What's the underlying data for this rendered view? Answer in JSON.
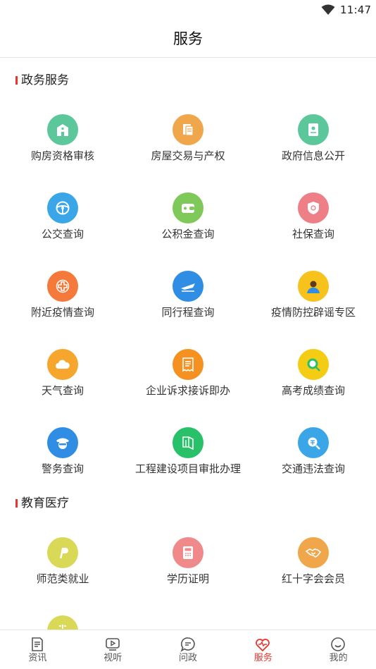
{
  "status_bar": {
    "time": "11:47"
  },
  "header": {
    "title": "服务"
  },
  "sections": [
    {
      "title": "政务服务",
      "items": [
        {
          "label": "购房资格审核",
          "icon": "building-icon",
          "color": "#5cc79a"
        },
        {
          "label": "房屋交易与产权",
          "icon": "document-icon",
          "color": "#f0a64a"
        },
        {
          "label": "政府信息公开",
          "icon": "info-card-icon",
          "color": "#5cc79a"
        },
        {
          "label": "公交查询",
          "icon": "steering-wheel-icon",
          "color": "#3aa6e8"
        },
        {
          "label": "公积金查询",
          "icon": "wallet-icon",
          "color": "#7ec95a"
        },
        {
          "label": "社保查询",
          "icon": "shield-icon",
          "color": "#ef7f86"
        },
        {
          "label": "附近疫情查询",
          "icon": "medical-cross-icon",
          "color": "#f5793a"
        },
        {
          "label": "同行程查询",
          "icon": "airplane-icon",
          "color": "#2f8de4"
        },
        {
          "label": "疫情防控辟谣专区",
          "icon": "person-icon",
          "color": "#f6c21b"
        },
        {
          "label": "天气查询",
          "icon": "cloud-icon",
          "color": "#f7a62d"
        },
        {
          "label": "企业诉求接诉即办",
          "icon": "receipt-icon",
          "color": "#f59120"
        },
        {
          "label": "高考成绩查询",
          "icon": "magnifier-icon",
          "color": "#f4cc14"
        },
        {
          "label": "警务查询",
          "icon": "police-icon",
          "color": "#2f8de4"
        },
        {
          "label": "工程建设项目审批办理",
          "icon": "book-icon",
          "color": "#28c16a"
        },
        {
          "label": "交通违法查询",
          "icon": "fine-search-icon",
          "color": "#3aa6e8"
        }
      ]
    },
    {
      "title": "教育医疗",
      "items": [
        {
          "label": "师范类就业",
          "icon": "paypal-icon",
          "color": "#d9d957"
        },
        {
          "label": "学历证明",
          "icon": "calculator-icon",
          "color": "#f08a8a"
        },
        {
          "label": "红十字会会员",
          "icon": "handshake-icon",
          "color": "#f0a64a"
        },
        {
          "label": "",
          "icon": "partial-icon",
          "color": "#d9d957"
        }
      ]
    }
  ],
  "tabbar": {
    "items": [
      {
        "label": "资讯",
        "icon": "news-icon",
        "active": false
      },
      {
        "label": "视听",
        "icon": "video-icon",
        "active": false
      },
      {
        "label": "问政",
        "icon": "chat-icon",
        "active": false
      },
      {
        "label": "服务",
        "icon": "heart-service-icon",
        "active": true
      },
      {
        "label": "我的",
        "icon": "smile-icon",
        "active": false
      }
    ],
    "active_color": "#e8352f"
  }
}
